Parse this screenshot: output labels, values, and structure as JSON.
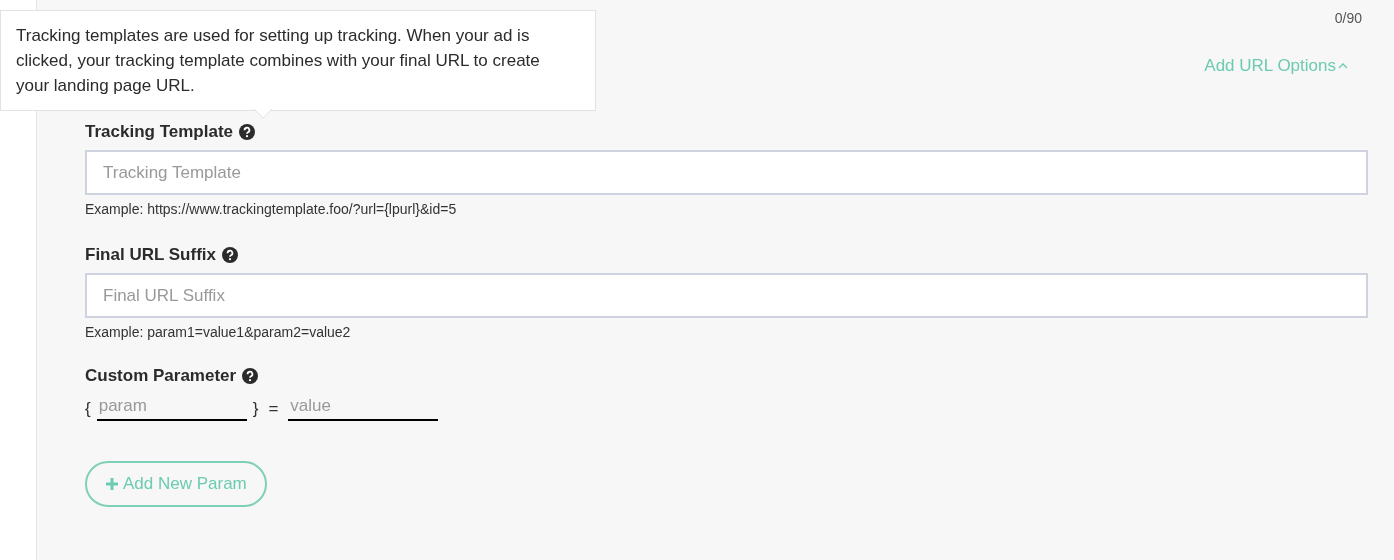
{
  "counter": "0/90",
  "url_options": {
    "label": "Add URL Options",
    "expanded": true
  },
  "tooltip": {
    "text": "Tracking templates are used for setting up tracking. When your ad is clicked, your tracking template combines with your final URL to create your landing page URL."
  },
  "fields": [
    {
      "label": "Tracking Template",
      "placeholder": "Tracking Template",
      "example": "Example: https://www.trackingtemplate.foo/?url={lpurl}&id=5"
    },
    {
      "label": "Final URL Suffix",
      "placeholder": "Final URL Suffix",
      "example": "Example: param1=value1&param2=value2"
    }
  ],
  "custom_parameter": {
    "label": "Custom Parameter",
    "open_brace": "{",
    "param_placeholder": "param",
    "close_brace": "}",
    "equals": "=",
    "value_placeholder": "value"
  },
  "add_button": {
    "label": "Add New Param"
  }
}
